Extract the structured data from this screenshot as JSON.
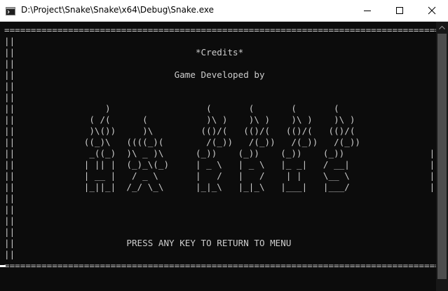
{
  "window": {
    "title": "D:\\Project\\Snake\\Snake\\x64\\Debug\\Snake.exe",
    "icon": "console-app-icon",
    "controls": [
      "minimize-icon",
      "maximize-icon",
      "close-icon"
    ]
  },
  "console": {
    "lines": [
      "===================================================================================",
      "||                                                                               ||",
      "||                                  *Credits*                                    ||",
      "||                                                                               ||",
      "||                              Game Developed by                                ||",
      "||                                                                               ||",
      "||                                                                               ||",
      "||                 )                  (       (       (       (                  ||",
      "||              ( /(      (           )\\ )    )\\ )    )\\ )    )\\ )               ||",
      "||              )\\())     )\\         (()/(   (()/(   (()/(   (()/(               ||",
      "||             ((_)\\   ((((_)(        /(_))   /(_))   /(_))   /(_))              ||",
      "||              _((_)  )\\ _ )\\      (_))    (_))    (_))    (_))                ||",
      "||             | || |  (_)_\\(_)     | _ \\   | _ \\   |_ _|   / __|               ||",
      "||             | __ |   / _ \\       |   /   |   /    | |    \\__ \\               ||",
      "||             |_||_|  /_/ \\_\\      |_|_\\   |_|_\\   |___|   |___/               ||",
      "||                                                                               ||",
      "||                                                                               ||",
      "||                                                                               ||",
      "||                                                                               ||",
      "||                     PRESS ANY KEY TO RETURN TO MENU                           ||",
      "||                                                                               ||",
      "==================================================================================="
    ]
  },
  "colors": {
    "console_bg": "#0c0c0c",
    "console_text": "#cccccc",
    "titlebar_bg": "#ffffff",
    "scrollbar_track": "#171717",
    "scrollbar_thumb": "#4d4d4d"
  }
}
